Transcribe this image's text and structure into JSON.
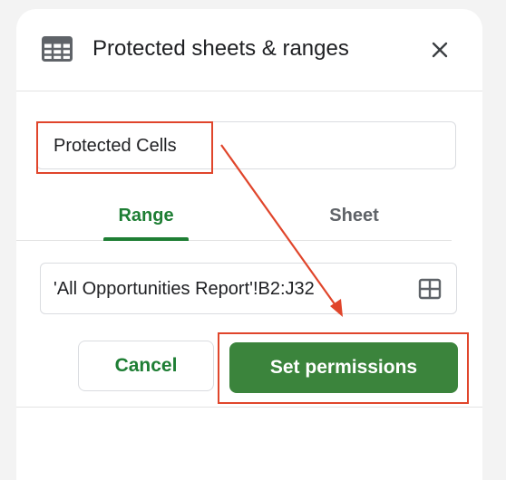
{
  "dialog": {
    "title": "Protected sheets & ranges",
    "icon": "sheet-icon",
    "close_icon": "close-icon"
  },
  "description": {
    "value": "Protected Cells"
  },
  "tabs": [
    {
      "label": "Range",
      "active": true
    },
    {
      "label": "Sheet",
      "active": false
    }
  ],
  "range": {
    "value": "'All Opportunities Report'!B2:J32",
    "icon": "grid-select-icon"
  },
  "actions": {
    "cancel_label": "Cancel",
    "set_permissions_label": "Set permissions"
  },
  "colors": {
    "accent_green": "#1e7e34",
    "primary_button": "#3b843c",
    "annotation_red": "#e0452b"
  }
}
